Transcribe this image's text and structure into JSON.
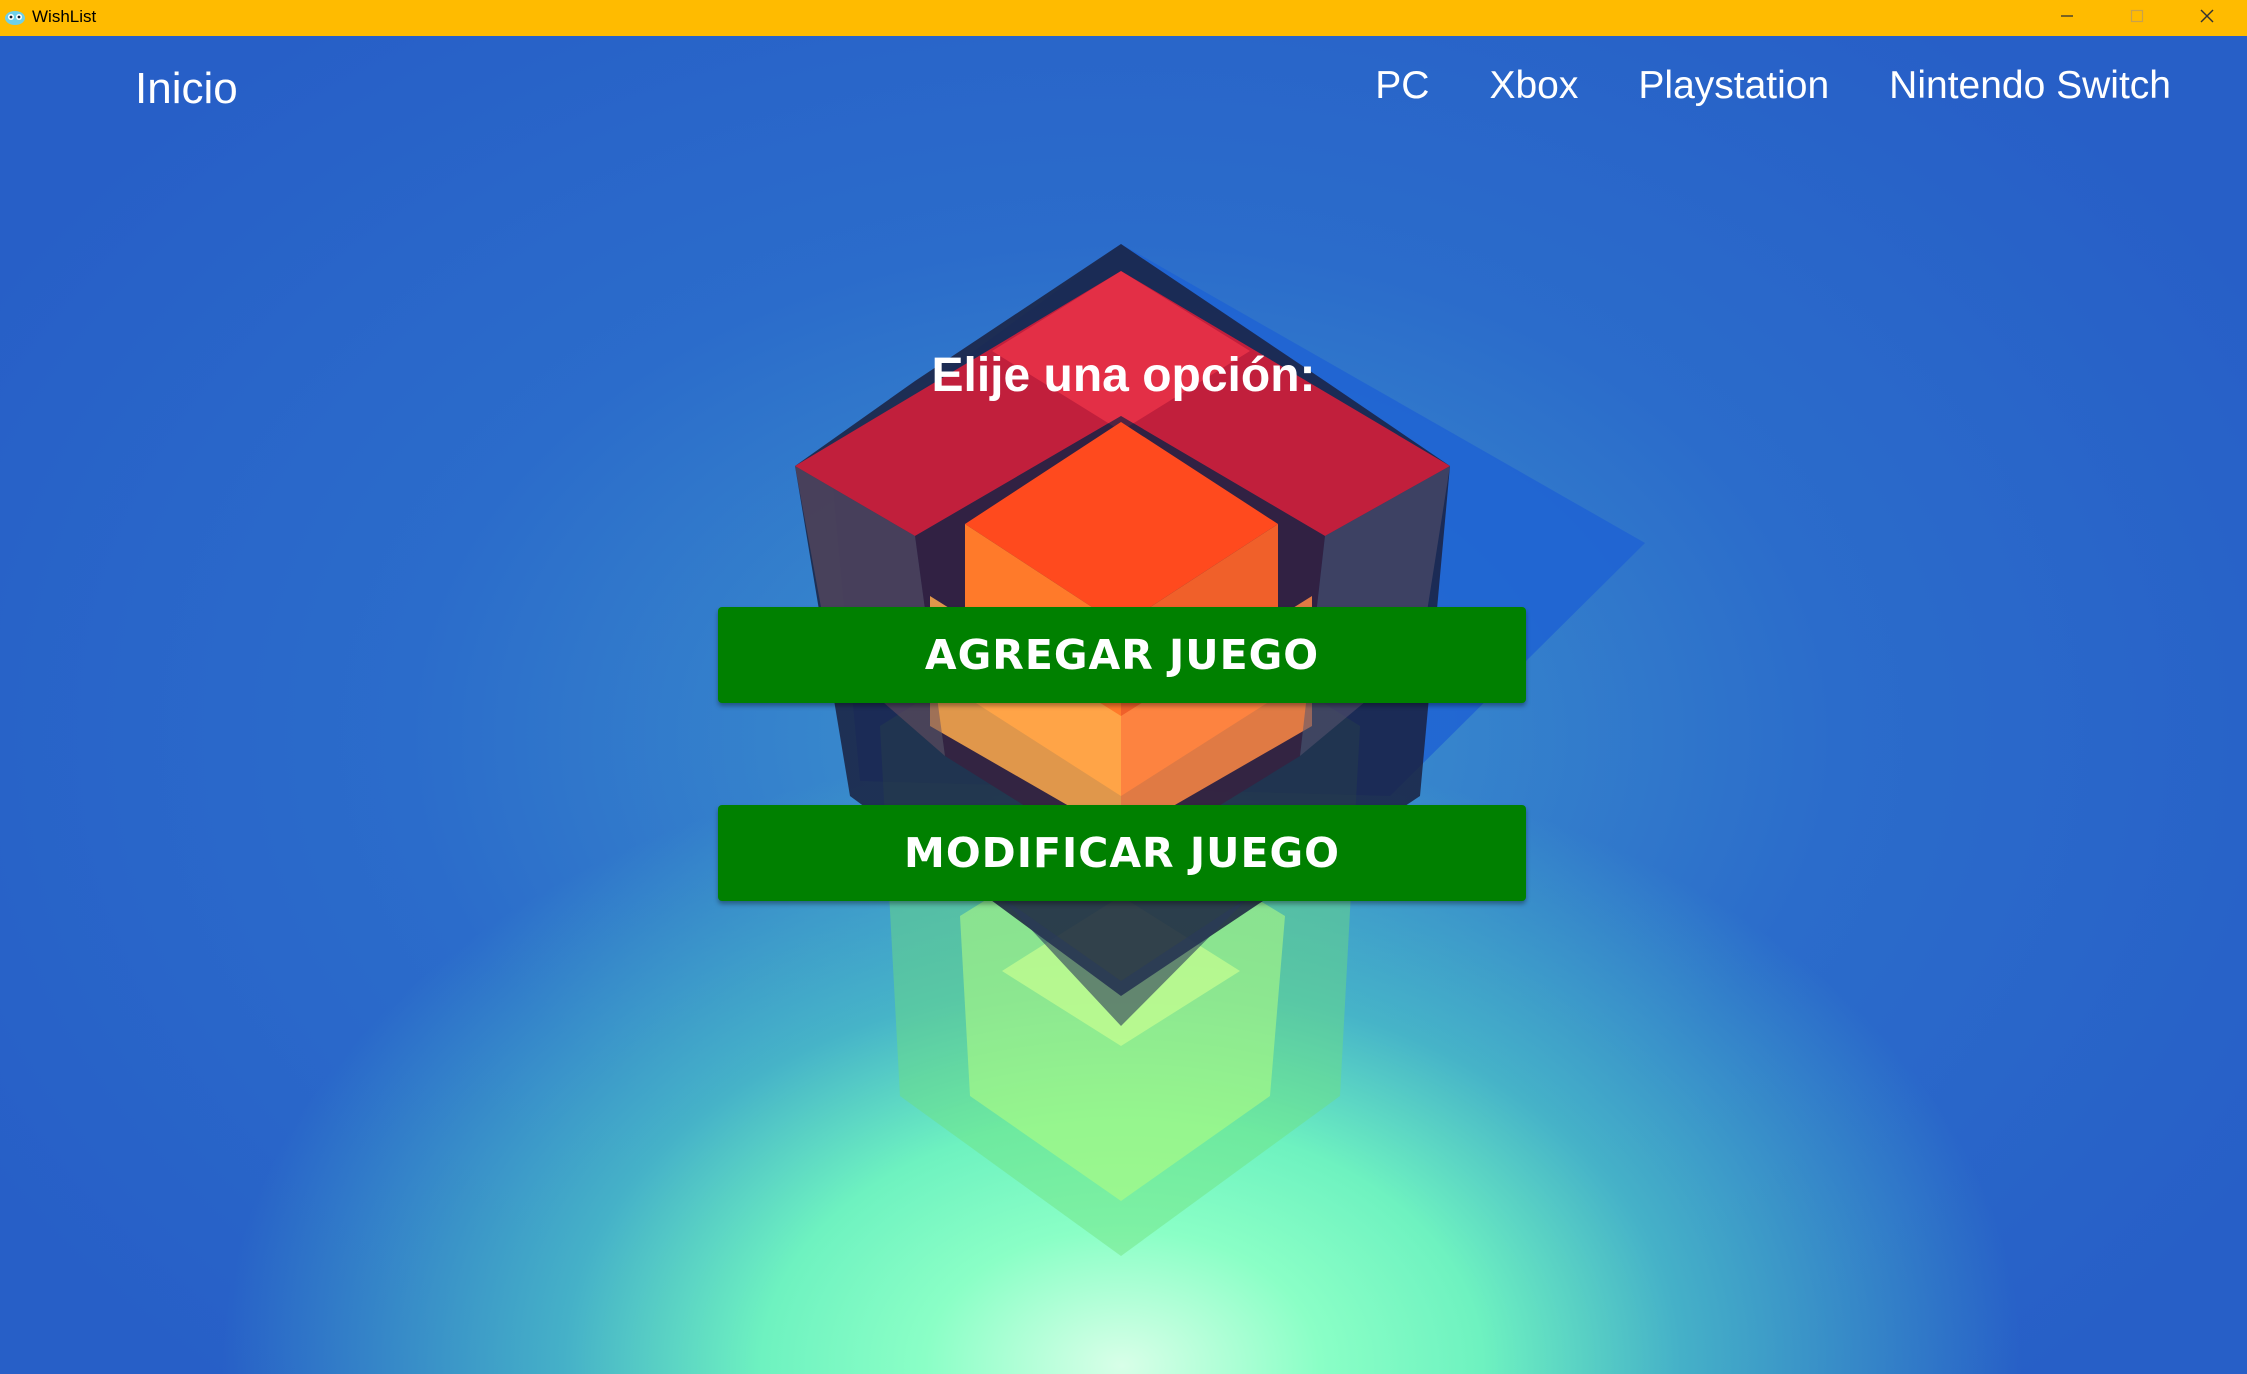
{
  "window": {
    "title": "WishList",
    "titlebar_color": "#ffbb00",
    "controls": [
      "minimize-icon",
      "maximize-icon",
      "close-icon"
    ]
  },
  "nav": {
    "home": "Inicio",
    "links": [
      "PC",
      "Xbox",
      "Playstation",
      "Nintendo Switch"
    ]
  },
  "main": {
    "prompt": "Elije una opción:",
    "buttons": {
      "add": "AGREGAR JUEGO",
      "edit": "MODIFICAR JUEGO"
    },
    "button_color": "#008000"
  },
  "background": {
    "art": "layered-cube-illustration"
  }
}
